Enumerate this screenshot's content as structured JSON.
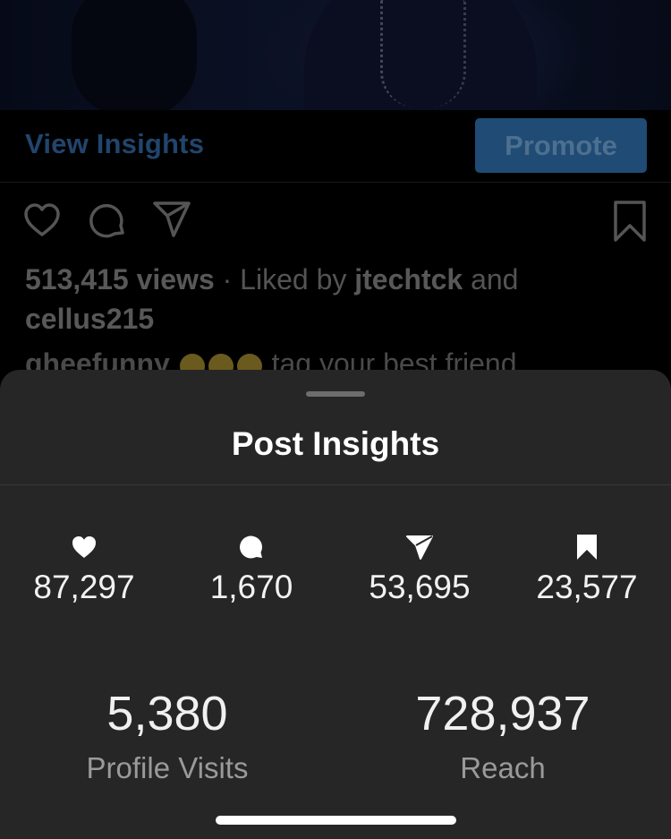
{
  "post": {
    "view_insights_label": "View Insights",
    "promote_label": "Promote",
    "views": "513,415 views",
    "liked_by_prefix": " · Liked by ",
    "liked_by_user": "jtechtck",
    "liked_by_and": " and",
    "liked_by_user2": "cellus215",
    "caption_user": "gheefunny",
    "caption_text": "tag your best friend"
  },
  "insights": {
    "title": "Post Insights",
    "stats": [
      {
        "icon": "heart-icon",
        "value": "87,297"
      },
      {
        "icon": "comment-icon",
        "value": "1,670"
      },
      {
        "icon": "send-icon",
        "value": "53,695"
      },
      {
        "icon": "bookmark-icon",
        "value": "23,577"
      }
    ],
    "profile_visits": {
      "value": "5,380",
      "label": "Profile Visits"
    },
    "reach": {
      "value": "728,937",
      "label": "Reach"
    }
  },
  "colors": {
    "sheet_bg": "#262626",
    "accent_dim": "#1f4b74"
  }
}
